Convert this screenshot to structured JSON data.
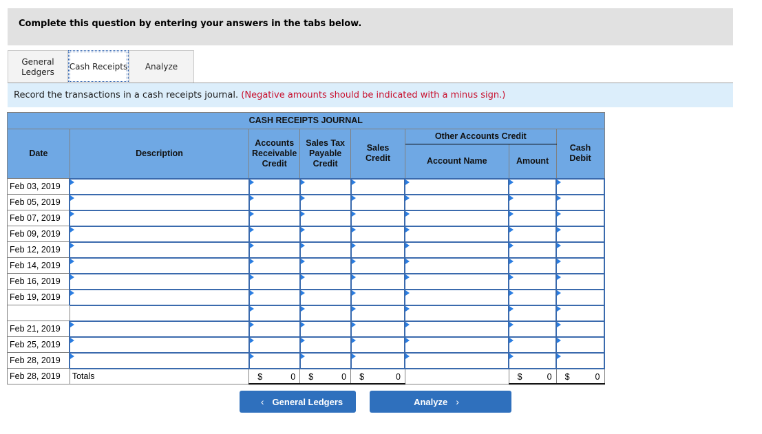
{
  "banner": {
    "text": "Complete this question by entering your answers in the tabs below."
  },
  "tabs": [
    {
      "label_line1": "General",
      "label_line2": "Ledgers",
      "active": false
    },
    {
      "label": "Cash Receipts",
      "active": true
    },
    {
      "label": "Analyze",
      "active": false
    }
  ],
  "instructions": {
    "text": "Record the transactions in a cash receipts journal.",
    "note": "(Negative amounts should be indicated with a minus sign.)"
  },
  "journal": {
    "title": "CASH RECEIPTS JOURNAL",
    "headers": {
      "date": "Date",
      "description": "Description",
      "ar_credit": [
        "Accounts",
        "Receivable",
        "Credit"
      ],
      "stp_credit": [
        "Sales Tax",
        "Payable",
        "Credit"
      ],
      "sales_credit": [
        "Sales",
        "Credit"
      ],
      "other_accounts": "Other Accounts Credit",
      "account_name": "Account Name",
      "amount": "Amount",
      "cash_debit": [
        "Cash",
        "Debit"
      ]
    },
    "rows": [
      {
        "date": "Feb 03, 2019"
      },
      {
        "date": "Feb 05, 2019"
      },
      {
        "date": "Feb 07, 2019"
      },
      {
        "date": "Feb 09, 2019"
      },
      {
        "date": "Feb 12, 2019"
      },
      {
        "date": "Feb 14, 2019"
      },
      {
        "date": "Feb 16, 2019"
      },
      {
        "date": "Feb 19, 2019"
      },
      {
        "date": ""
      },
      {
        "date": "Feb 21, 2019"
      },
      {
        "date": "Feb 25, 2019"
      },
      {
        "date": "Feb 28, 2019"
      }
    ],
    "totals": {
      "date": "Feb 28, 2019",
      "label": "Totals",
      "currency": "$",
      "ar_credit": "0",
      "stp_credit": "0",
      "sales_credit": "0",
      "amount": "0",
      "cash_debit": "0"
    }
  },
  "nav": {
    "prev_label": "General Ledgers",
    "prev_icon": "‹",
    "next_label": "Analyze",
    "next_icon": "›"
  }
}
